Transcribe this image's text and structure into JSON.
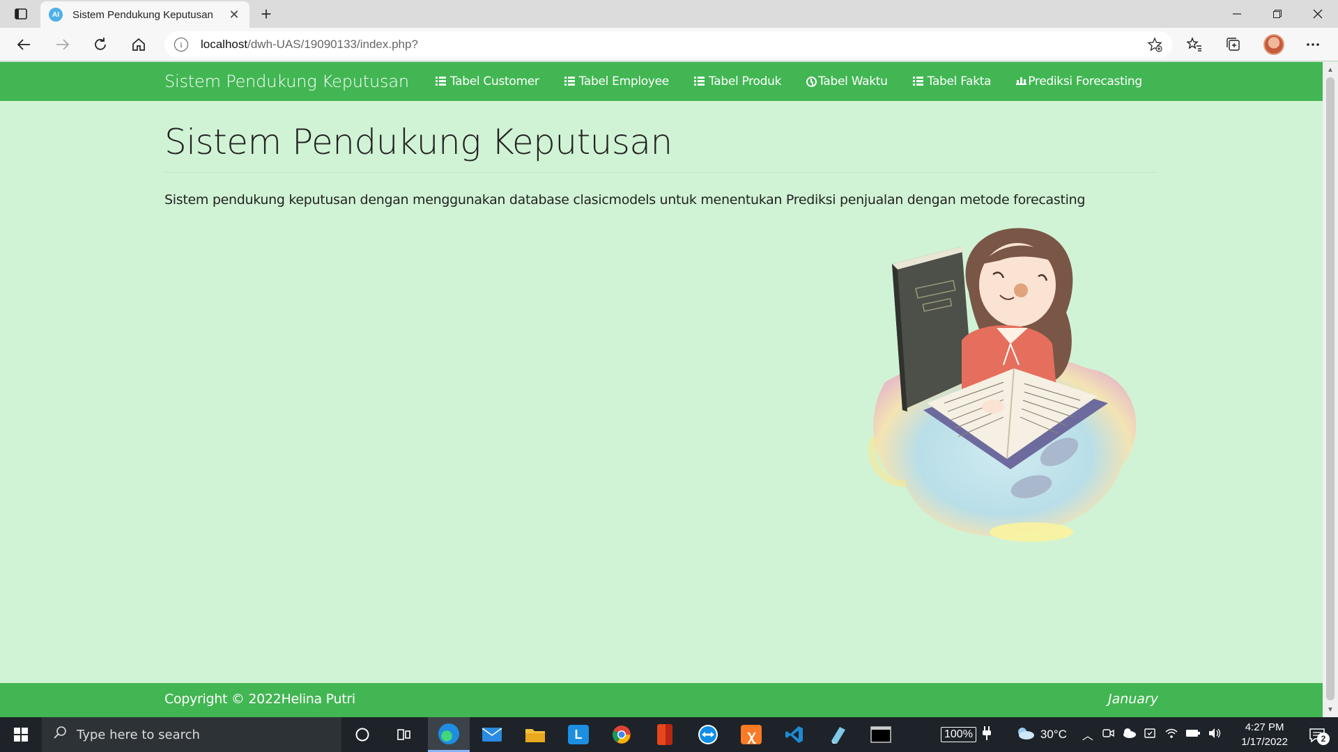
{
  "browser": {
    "tab_title": "Sistem Pendukung Keputusan",
    "favicon_text": "AI",
    "url_host": "localhost",
    "url_path": "/dwh-UAS/19090133/index.php?"
  },
  "navbar": {
    "brand": "Sistem Pendukung Keputusan",
    "items": [
      {
        "label": "Tabel Customer",
        "icon": "list-icon"
      },
      {
        "label": "Tabel Employee",
        "icon": "list-icon"
      },
      {
        "label": "Tabel Produk",
        "icon": "list-icon"
      },
      {
        "label": "Tabel Waktu",
        "icon": "clock-icon"
      },
      {
        "label": "Tabel Fakta",
        "icon": "list-icon"
      },
      {
        "label": "Prediksi Forecasting",
        "icon": "bar-chart-icon"
      }
    ]
  },
  "main": {
    "title": "Sistem Pendukung Keputusan",
    "description": "Sistem pendukung keputusan dengan menggunakan database clasicmodels untuk menentukan Prediksi penjualan dengan metode forecasting"
  },
  "footer": {
    "copyright": "Copyright © 2022Helina Putri",
    "month": "January"
  },
  "taskbar": {
    "search_placeholder": "Type here to search",
    "battery": "100%",
    "temperature": "30°C",
    "time": "4:27 PM",
    "date": "1/17/2022",
    "notifications": "2"
  },
  "colors": {
    "navbar": "#42b653",
    "page_bg": "#d1f3d5"
  }
}
